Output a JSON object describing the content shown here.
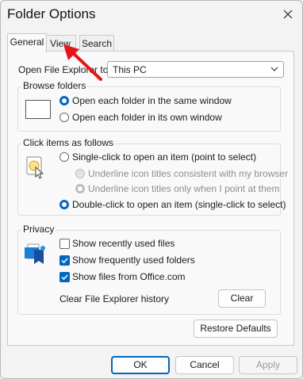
{
  "window": {
    "title": "Folder Options"
  },
  "tabs": [
    {
      "label": "General"
    },
    {
      "label": "View"
    },
    {
      "label": "Search"
    }
  ],
  "general": {
    "open_explorer_label": "Open File Explorer to:",
    "open_explorer_value": "This PC",
    "browse_folders": {
      "title": "Browse folders",
      "options": [
        {
          "label": "Open each folder in the same window",
          "selected": true
        },
        {
          "label": "Open each folder in its own window",
          "selected": false
        }
      ]
    },
    "click_items": {
      "title": "Click items as follows",
      "single_click": "Single-click to open an item (point to select)",
      "sub_options": [
        {
          "label": "Underline icon titles consistent with my browser",
          "selected": false
        },
        {
          "label": "Underline icon titles only when I point at them",
          "selected": true
        }
      ],
      "double_click": "Double-click to open an item (single-click to select)"
    },
    "privacy": {
      "title": "Privacy",
      "options": [
        {
          "label": "Show recently used files",
          "checked": false
        },
        {
          "label": "Show frequently used folders",
          "checked": true
        },
        {
          "label": "Show files from Office.com",
          "checked": true
        }
      ],
      "clear_history_label": "Clear File Explorer history",
      "clear_button": "Clear"
    },
    "restore_button": "Restore Defaults"
  },
  "footer": {
    "ok": "OK",
    "cancel": "Cancel",
    "apply": "Apply"
  },
  "colors": {
    "accent": "#0067c0",
    "annotation_arrow": "#e8131b"
  }
}
